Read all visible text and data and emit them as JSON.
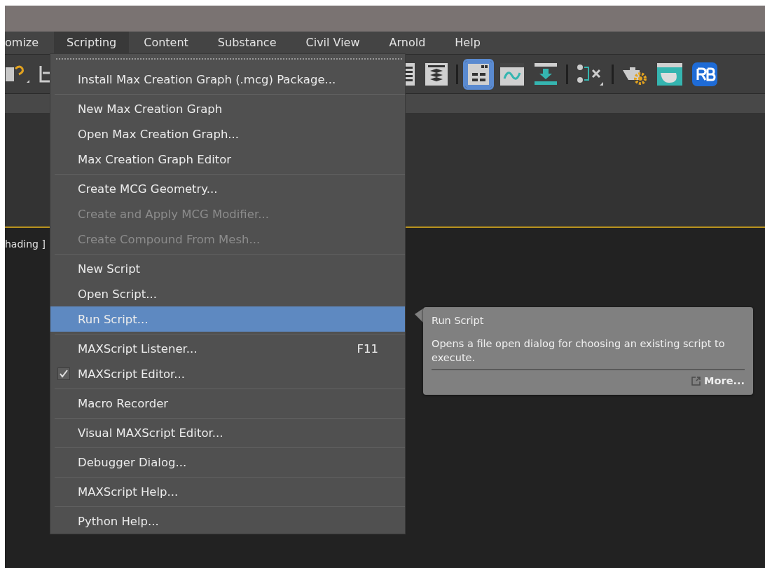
{
  "menu_bar": [
    {
      "label": "omize",
      "selected": false
    },
    {
      "label": "Scripting",
      "selected": true
    },
    {
      "label": "Content",
      "selected": false
    },
    {
      "label": "Substance",
      "selected": false
    },
    {
      "label": "Civil View",
      "selected": false
    },
    {
      "label": "Arnold",
      "selected": false
    },
    {
      "label": "Help",
      "selected": false
    }
  ],
  "toolbar": [
    {
      "kind": "help",
      "selected": false
    },
    {
      "kind": "partial",
      "selected": false
    },
    {
      "kind": "gap"
    },
    {
      "kind": "list",
      "selected": false
    },
    {
      "kind": "layers",
      "selected": false
    },
    {
      "kind": "separator"
    },
    {
      "kind": "panels",
      "selected": true
    },
    {
      "kind": "curve",
      "selected": false
    },
    {
      "kind": "download",
      "selected": false
    },
    {
      "kind": "separator"
    },
    {
      "kind": "schematic",
      "selected": false
    },
    {
      "kind": "separator"
    },
    {
      "kind": "render-setup",
      "selected": false
    },
    {
      "kind": "render-frame",
      "selected": false
    },
    {
      "kind": "rb",
      "selected": false
    }
  ],
  "viewport_label": "hading ]",
  "menu": {
    "groups": [
      [
        {
          "label": "Install Max Creation Graph (.mcg) Package...",
          "disabled": false,
          "checked": false,
          "selected": false
        }
      ],
      [
        {
          "label": "New Max Creation Graph",
          "disabled": false,
          "checked": false,
          "selected": false
        },
        {
          "label": "Open Max Creation Graph...",
          "disabled": false,
          "checked": false,
          "selected": false
        },
        {
          "label": "Max Creation Graph Editor",
          "disabled": false,
          "checked": false,
          "selected": false
        }
      ],
      [
        {
          "label": "Create MCG Geometry...",
          "disabled": false,
          "checked": false,
          "selected": false
        },
        {
          "label": "Create and Apply MCG Modifier...",
          "disabled": true,
          "checked": false,
          "selected": false
        },
        {
          "label": "Create Compound From Mesh...",
          "disabled": true,
          "checked": false,
          "selected": false
        }
      ],
      [
        {
          "label": "New Script",
          "disabled": false,
          "checked": false,
          "selected": false
        },
        {
          "label": "Open Script...",
          "disabled": false,
          "checked": false,
          "selected": false
        },
        {
          "label": "Run Script...",
          "disabled": false,
          "checked": false,
          "selected": true
        }
      ],
      [
        {
          "label": "MAXScript Listener...",
          "shortcut": "F11",
          "disabled": false,
          "checked": false,
          "selected": false
        },
        {
          "label": "MAXScript Editor...",
          "disabled": false,
          "checked": true,
          "selected": false
        }
      ],
      [
        {
          "label": "Macro Recorder",
          "disabled": false,
          "checked": false,
          "selected": false
        }
      ],
      [
        {
          "label": "Visual MAXScript Editor...",
          "disabled": false,
          "checked": false,
          "selected": false
        }
      ],
      [
        {
          "label": "Debugger Dialog...",
          "disabled": false,
          "checked": false,
          "selected": false
        }
      ],
      [
        {
          "label": "MAXScript Help...",
          "disabled": false,
          "checked": false,
          "selected": false
        }
      ],
      [
        {
          "label": "Python Help...",
          "disabled": false,
          "checked": false,
          "selected": false
        }
      ]
    ]
  },
  "tooltip": {
    "title": "Run Script",
    "description": "Opens a file open dialog for choosing an existing script to execute.",
    "link": "More..."
  }
}
